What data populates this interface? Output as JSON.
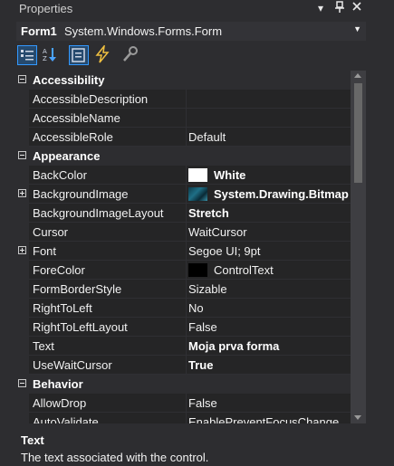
{
  "window": {
    "title": "Properties"
  },
  "object": {
    "name": "Form1",
    "type": "System.Windows.Forms.Form"
  },
  "toolbar": {
    "buttons": [
      {
        "icon": "categorized-icon",
        "active": true
      },
      {
        "icon": "alphabetical-icon",
        "active": false
      },
      {
        "icon": "properties-icon",
        "active": true
      },
      {
        "icon": "events-icon",
        "active": false
      },
      {
        "icon": "property-pages-icon",
        "active": false
      }
    ]
  },
  "rows": [
    {
      "kind": "category",
      "label": "Accessibility"
    },
    {
      "kind": "prop",
      "name": "AccessibleDescription",
      "value": ""
    },
    {
      "kind": "prop",
      "name": "AccessibleName",
      "value": ""
    },
    {
      "kind": "prop",
      "name": "AccessibleRole",
      "value": "Default"
    },
    {
      "kind": "category",
      "label": "Appearance"
    },
    {
      "kind": "prop",
      "name": "BackColor",
      "value": "White",
      "bold": true,
      "swatch": "#ffffff"
    },
    {
      "kind": "prop",
      "name": "BackgroundImage",
      "value": "System.Drawing.Bitmap",
      "bold": true,
      "thumb": true,
      "expandable": true
    },
    {
      "kind": "prop",
      "name": "BackgroundImageLayout",
      "value": "Stretch",
      "bold": true
    },
    {
      "kind": "prop",
      "name": "Cursor",
      "value": "WaitCursor"
    },
    {
      "kind": "prop",
      "name": "Font",
      "value": "Segoe UI; 9pt",
      "expandable": true
    },
    {
      "kind": "prop",
      "name": "ForeColor",
      "value": "ControlText",
      "swatch": "#000000"
    },
    {
      "kind": "prop",
      "name": "FormBorderStyle",
      "value": "Sizable"
    },
    {
      "kind": "prop",
      "name": "RightToLeft",
      "value": "No"
    },
    {
      "kind": "prop",
      "name": "RightToLeftLayout",
      "value": "False"
    },
    {
      "kind": "prop",
      "name": "Text",
      "value": "Moja prva forma",
      "bold": true
    },
    {
      "kind": "prop",
      "name": "UseWaitCursor",
      "value": "True",
      "bold": true
    },
    {
      "kind": "category",
      "label": "Behavior"
    },
    {
      "kind": "prop",
      "name": "AllowDrop",
      "value": "False"
    },
    {
      "kind": "prop",
      "name": "AutoValidate",
      "value": "EnablePreventFocusChange"
    }
  ],
  "description": {
    "title": "Text",
    "text": "The text associated with the control."
  },
  "colors": {
    "accent": "#3399ff",
    "background": "#2d2d30",
    "grid": "#252526"
  }
}
